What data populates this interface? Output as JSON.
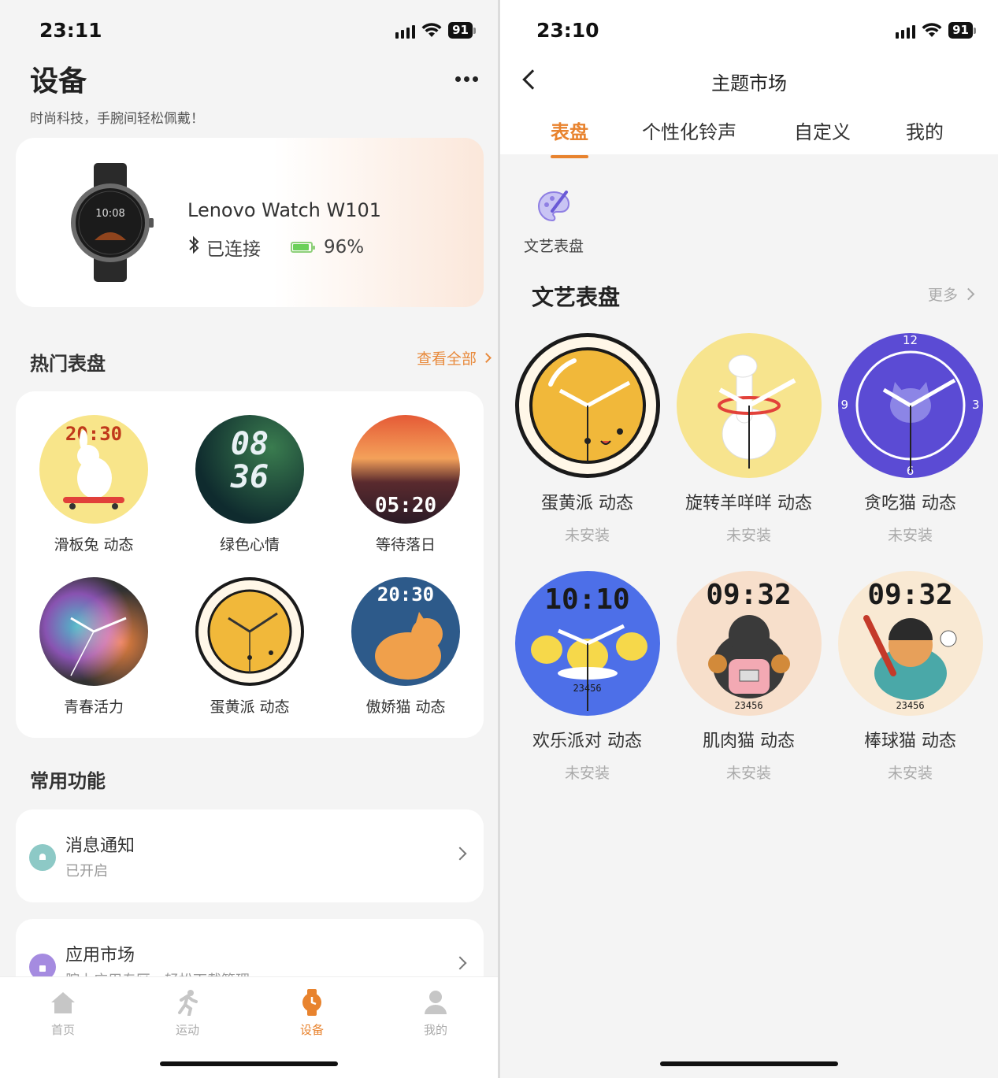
{
  "left": {
    "status": {
      "time": "23:11",
      "battery": "91"
    },
    "title": "设备",
    "subtitle": "时尚科技，手腕间轻松佩戴！",
    "device": {
      "name": "Lenovo Watch W101",
      "connection": "已连接",
      "battery": "96%",
      "watch_time": "10:08"
    },
    "hot": {
      "title": "热门表盘",
      "view_all": "查看全部",
      "items": [
        {
          "label": "滑板兔 动态",
          "face_time": "20:30"
        },
        {
          "label": "绿色心情",
          "face_top": "08",
          "face_bottom": "36"
        },
        {
          "label": "等待落日",
          "face_time": "05:20"
        },
        {
          "label": "青春活力"
        },
        {
          "label": "蛋黄派 动态"
        },
        {
          "label": "傲娇猫 动态",
          "face_time": "20:30"
        }
      ]
    },
    "common": {
      "title": "常用功能",
      "items": [
        {
          "title": "消息通知",
          "sub": "已开启"
        },
        {
          "title": "应用市场",
          "sub": "腕上应用专区，轻松下载管理"
        }
      ]
    },
    "tabs": [
      {
        "label": "首页",
        "icon": "home-icon"
      },
      {
        "label": "运动",
        "icon": "run-icon"
      },
      {
        "label": "设备",
        "icon": "watch-icon"
      },
      {
        "label": "我的",
        "icon": "user-icon"
      }
    ],
    "accent": "#e8832e"
  },
  "right": {
    "status": {
      "time": "23:10",
      "battery": "91"
    },
    "title": "主题市场",
    "tabs": [
      "表盘",
      "个性化铃声",
      "自定义",
      "我的"
    ],
    "category": {
      "label": "文艺表盘",
      "icon": "palette-brush-icon"
    },
    "section": {
      "title": "文艺表盘",
      "more": "更多"
    },
    "faces": [
      {
        "label": "蛋黄派 动态",
        "status": "未安装"
      },
      {
        "label": "旋转羊咩咩 动态",
        "status": "未安装"
      },
      {
        "label": "贪吃猫 动态",
        "status": "未安装",
        "n12": "12",
        "n3": "3",
        "n6": "6",
        "n9": "9"
      },
      {
        "label": "欢乐派对 动态",
        "status": "未安装",
        "face_time": "10:10",
        "steps": "23456"
      },
      {
        "label": "肌肉猫 动态",
        "status": "未安装",
        "face_time": "09:32",
        "steps": "23456"
      },
      {
        "label": "棒球猫 动态",
        "status": "未安装",
        "face_time": "09:32",
        "steps": "23456"
      }
    ]
  }
}
